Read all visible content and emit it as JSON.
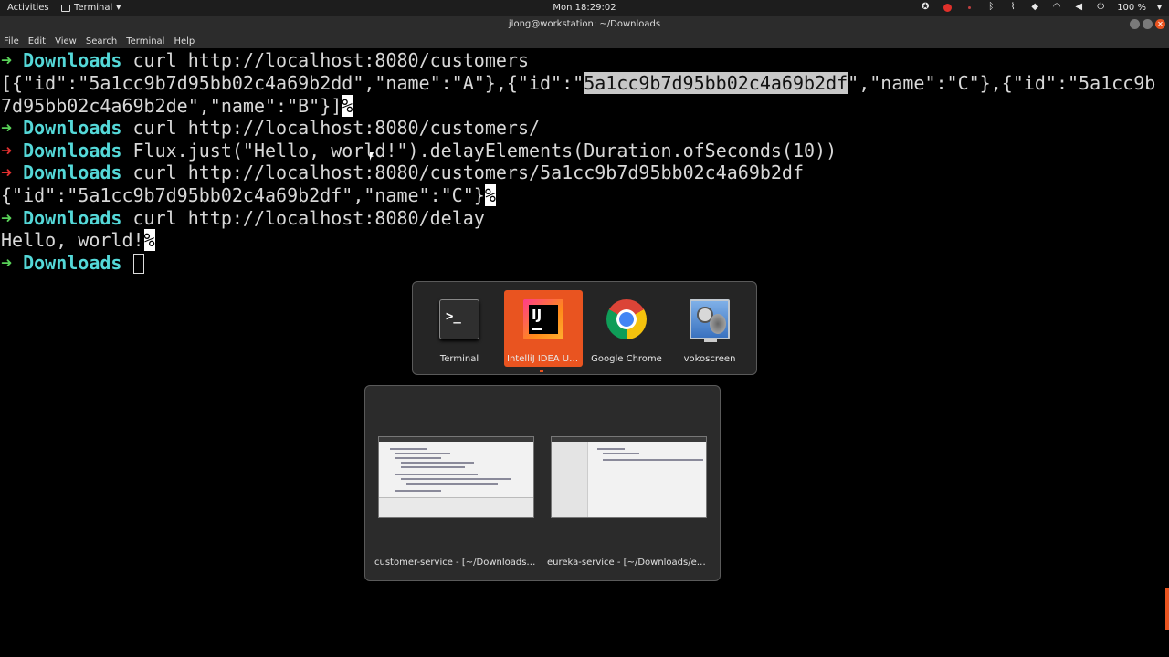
{
  "topbar": {
    "activities": "Activities",
    "app_menu": "Terminal",
    "app_menu_arrow": "▾",
    "clock": "Mon 18:29:02",
    "battery": "100 %",
    "battery_arrow": "▾"
  },
  "window": {
    "title": "jlong@workstation: ~/Downloads"
  },
  "menubar": {
    "items": [
      "File",
      "Edit",
      "View",
      "Search",
      "Terminal",
      "Help"
    ]
  },
  "terminal": {
    "prompt_arrow": "➜",
    "dir": "Downloads",
    "lines": {
      "l1_cmd": "curl http://localhost:8080/customers",
      "l2_a": "[{\"id\":\"5a1cc9b7d95bb02c4a69b2dd\",\"name\":\"A\"},{\"id\":\"",
      "l2_hl": "5a1cc9b7d95bb02c4a69b2df",
      "l2_b": "\",\"name\":\"C\"},{\"id\":\"5a1cc9b",
      "l3_a": "7d95bb02c4a69b2de\",\"name\":\"B\"}]",
      "pct": "%",
      "l4_cmd": "curl http://localhost:8080/customers/",
      "l5_cmd": "Flux.just(\"Hello, world!\").delayElements(Duration.ofSeconds(10))",
      "l6_cmd": "curl http://localhost:8080/customers/5a1cc9b7d95bb02c4a69b2df",
      "l7_a": "{\"id\":\"5a1cc9b7d95bb02c4a69b2df\",\"name\":\"C\"}",
      "l8_cmd": "curl http://localhost:8080/delay",
      "l9_a": "Hello, world!"
    }
  },
  "switcher": {
    "apps": [
      {
        "label": "Terminal",
        "selected": false
      },
      {
        "label": "IntelliJ IDEA Ul...",
        "selected": true
      },
      {
        "label": "Google Chrome",
        "selected": false
      },
      {
        "label": "vokoscreen",
        "selected": false
      }
    ],
    "terminal_glyph": ">_",
    "ij_glyph": "IJ"
  },
  "windows": [
    {
      "label": "customer-service - [~/Downloads/cu..."
    },
    {
      "label": "eureka-service - [~/Downloads/eure..."
    }
  ],
  "colors": {
    "accent": "#e95420",
    "prompt_ok": "#58d058",
    "prompt_err": "#e03030",
    "dir": "#54d8d8"
  }
}
